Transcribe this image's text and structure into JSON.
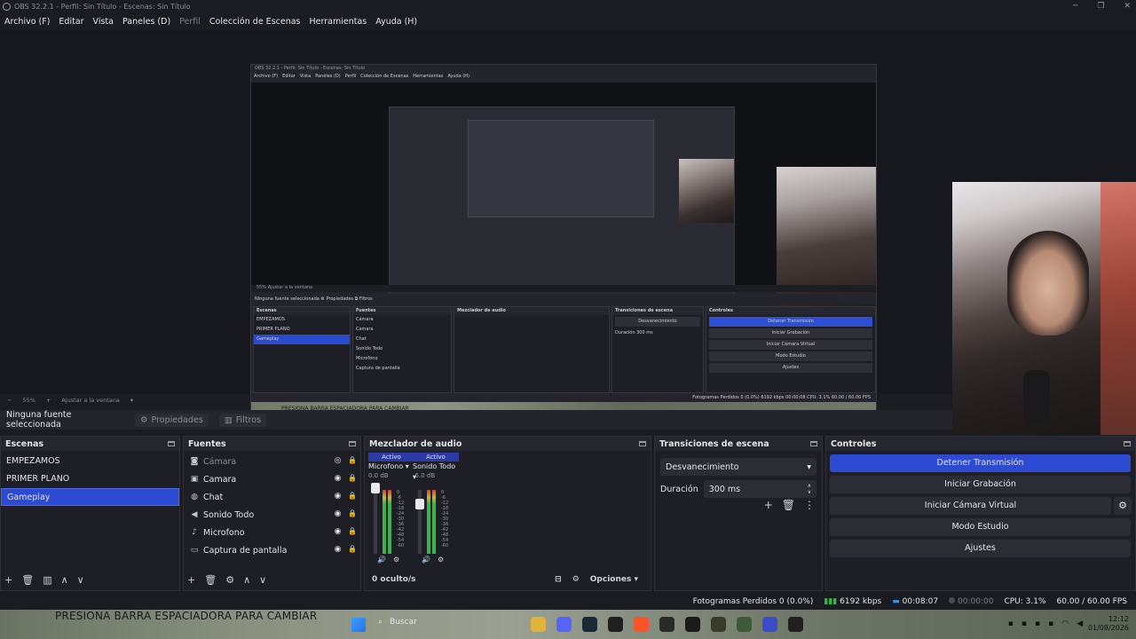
{
  "window": {
    "title": "OBS 32.2.1 - Perfil: Sin Título - Escenas: Sin Título",
    "minimize": "─",
    "maximize": "❐",
    "close": "✕"
  },
  "menu": {
    "archivo": "Archivo (F)",
    "editar": "Editar",
    "vista": "Vista",
    "paneles": "Paneles (D)",
    "perfil": "Perfil",
    "coleccion": "Colección de Escenas",
    "herramientas": "Herramientas",
    "ayuda": "Ayuda (H)"
  },
  "nested": {
    "title": "OBS 32.2.1 - Perfil: Sin Título - Escenas: Sin Título",
    "menu": [
      "Archivo (F)",
      "Editar",
      "Vista",
      "Paneles (D)",
      "Perfil",
      "Colección de Escenas",
      "Herramientas",
      "Ayuda (H)"
    ],
    "toolbar": "55%   Ajustar a la ventana",
    "props": "Ninguna fuente seleccionada   ⚙ Propiedades   ⧉ Filtros",
    "scenes_head": "Escenas",
    "scenes": [
      "EMPEZAMOS",
      "PRIMER PLANO",
      "Gameplay"
    ],
    "sources_head": "Fuentes",
    "sources": [
      "Cámara",
      "Camara",
      "Chat",
      "Sonido Todo",
      "Microfono",
      "Captura de pantalla"
    ],
    "mixer_head": "Mezclador de audio",
    "trans_head": "Transiciones de escena",
    "trans_value": "Desvanecimiento",
    "trans_duration": "Duración   300 ms",
    "ctrl_head": "Controles",
    "ctrl_buttons": [
      "Detener Transmisión",
      "Iniciar Grabación",
      "Iniciar Cámara Virtual",
      "Modo Estudio",
      "Ajustes"
    ],
    "status": "Fotogramas Perdidos 0 (0.0%)   6192 kbps   00:00:08   CPU: 3.1%   60.00 / 60.00 FPS",
    "taskbar_text": "PRESIONA BARRA ESPACIADORA PARA CAMBIAR"
  },
  "zoom": {
    "minus": "−",
    "level": "55%",
    "plus": "+",
    "mode": "Ajustar a la ventana"
  },
  "source_bar": {
    "none_selected": "Ninguna fuente seleccionada",
    "properties": "Propiedades",
    "filters": "Filtros"
  },
  "scenes": {
    "header": "Escenas",
    "items": [
      {
        "label": "EMPEZAMOS",
        "selected": false
      },
      {
        "label": "PRIMER PLANO",
        "selected": false
      },
      {
        "label": "Gameplay",
        "selected": true
      }
    ],
    "footer": [
      "+",
      "🗑",
      "▥",
      "∧",
      "∨"
    ]
  },
  "sources": {
    "header": "Fuentes",
    "items": [
      {
        "label": "Cámara",
        "icon": "camera-icon",
        "visible": false
      },
      {
        "label": "Camara",
        "icon": "video-icon",
        "visible": true
      },
      {
        "label": "Chat",
        "icon": "globe-icon",
        "visible": true
      },
      {
        "label": "Sonido Todo",
        "icon": "speaker-icon",
        "visible": true
      },
      {
        "label": "Microfono",
        "icon": "mic-icon",
        "visible": true
      },
      {
        "label": "Captura de pantalla",
        "icon": "monitor-icon",
        "visible": true
      }
    ],
    "footer": [
      "+",
      "🗑",
      "⚙",
      "∧",
      "∨"
    ]
  },
  "mixer": {
    "header": "Mezclador de audio",
    "channels": [
      {
        "name": "Microfono",
        "status": "Activo",
        "db": "0.0 dB",
        "level": 0.82
      },
      {
        "name": "Sonido Todo",
        "status": "Activo",
        "db": "-6.0 dB",
        "level": 0.68
      }
    ],
    "scale": [
      "0",
      "-6",
      "-12",
      "-18",
      "-24",
      "-30",
      "-36",
      "-42",
      "-48",
      "-54",
      "-60"
    ],
    "hidden": "0 oculto/s",
    "options": "Opciones"
  },
  "transitions": {
    "header": "Transiciones de escena",
    "selected": "Desvanecimiento",
    "duration_label": "Duración",
    "duration_value": "300 ms"
  },
  "controls": {
    "header": "Controles",
    "stream": "Detener Transmisión",
    "record": "Iniciar Grabación",
    "virtual_cam": "Iniciar Cámara Virtual",
    "studio": "Modo Estudio",
    "settings": "Ajustes"
  },
  "status": {
    "dropped": "Fotogramas Perdidos 0 (0.0%)",
    "bitrate": "6192 kbps",
    "stream_time": "00:08:07",
    "rec_time": "00:00:00",
    "cpu": "CPU: 3.1%",
    "fps": "60.00 / 60.00 FPS"
  },
  "taskbar": {
    "overlay_text": "PRESIONA BARRA ESPACIADORA PARA CAMBIAR",
    "search": "Buscar",
    "time": "12:12",
    "date": "01/08/2026"
  },
  "colors": {
    "accent": "#2d4ad3",
    "background": "#1b1c22",
    "meter_green": "#3ab44a"
  }
}
